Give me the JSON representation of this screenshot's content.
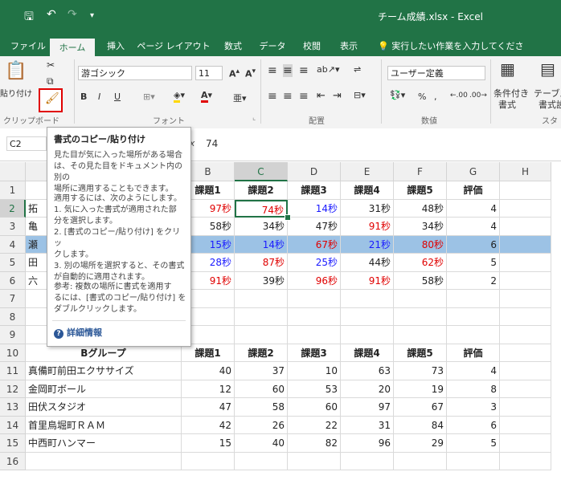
{
  "title_bar": {
    "title": "チーム成績.xlsx  -  Excel",
    "save_icon": "save-icon",
    "undo_icon": "undo-icon",
    "redo_icon": "redo-icon"
  },
  "tabs": [
    {
      "label": "ファイル"
    },
    {
      "label": "ホーム"
    },
    {
      "label": "挿入"
    },
    {
      "label": "ページ レイアウト"
    },
    {
      "label": "数式"
    },
    {
      "label": "データ"
    },
    {
      "label": "校閲"
    },
    {
      "label": "表示"
    }
  ],
  "tell_me": "実行したい作業を入力してください",
  "ribbon": {
    "paste_label": "貼り付け",
    "clipboard_label": "クリップボード",
    "font_name": "游ゴシック",
    "font_size": "11",
    "font_group_label": "フォント",
    "align_group_label": "配置",
    "number_format": "ユーザー定義",
    "number_group_label": "数値",
    "conditional_label_1": "条件付き",
    "conditional_label_2": "書式",
    "table_label_1": "テーブル",
    "table_label_2": "書式設",
    "styles_label": "スタ",
    "bold": "B",
    "italic": "I",
    "underline": "U",
    "percent": "%",
    "comma": ","
  },
  "formula_bar": {
    "name_box": "C2",
    "fx": "fx",
    "value": "74"
  },
  "tooltip": {
    "title": "書式のコピー/貼り付け",
    "para1": [
      "見た目が気に入った場所がある場合",
      "は、その見た目をドキュメント内の別の",
      "場所に適用することもできます。"
    ],
    "para2": [
      "適用するには、次のようにします。",
      "1. 気に入った書式が適用された部",
      "分を選択します。",
      "2. [書式のコピー/貼り付け] をクリッ",
      "クします。",
      "3. 別の場所を選択すると、その書式",
      "が自動的に適用されます。"
    ],
    "para3": [
      "参考: 複数の場所に書式を適用す",
      "るには、[書式のコピー/貼り付け] を",
      "ダブルクリックします。"
    ],
    "help": "詳細情報"
  },
  "columns": [
    "A",
    "B",
    "C",
    "D",
    "E",
    "F",
    "G",
    "H"
  ],
  "selected_column": "C",
  "row_numbers": [
    "1",
    "2",
    "3",
    "4",
    "5",
    "6",
    "7",
    "8",
    "9",
    "10",
    "11",
    "12",
    "13",
    "14",
    "15",
    "16"
  ],
  "sheet": {
    "header_row1": [
      "",
      "課題1",
      "課題2",
      "課題3",
      "課題4",
      "課題5",
      "評価"
    ],
    "rows_top": [
      {
        "name": "拓",
        "cells": [
          {
            "v": "97秒",
            "c": "red"
          },
          {
            "v": "74秒",
            "c": "red"
          },
          {
            "v": "14秒",
            "c": "blue"
          },
          {
            "v": "31秒",
            "c": ""
          },
          {
            "v": "48秒",
            "c": ""
          },
          {
            "v": "4",
            "c": ""
          }
        ]
      },
      {
        "name": "亀",
        "cells": [
          {
            "v": "58秒",
            "c": ""
          },
          {
            "v": "34秒",
            "c": ""
          },
          {
            "v": "47秒",
            "c": ""
          },
          {
            "v": "91秒",
            "c": "red"
          },
          {
            "v": "34秒",
            "c": ""
          },
          {
            "v": "4",
            "c": ""
          }
        ]
      },
      {
        "name": "瀬",
        "cells": [
          {
            "v": "15秒",
            "c": "blue"
          },
          {
            "v": "14秒",
            "c": "blue"
          },
          {
            "v": "67秒",
            "c": "red"
          },
          {
            "v": "21秒",
            "c": "blue"
          },
          {
            "v": "80秒",
            "c": "red"
          },
          {
            "v": "6",
            "c": ""
          }
        ]
      },
      {
        "name": "田",
        "cells": [
          {
            "v": "28秒",
            "c": "blue"
          },
          {
            "v": "87秒",
            "c": "red"
          },
          {
            "v": "25秒",
            "c": "blue"
          },
          {
            "v": "44秒",
            "c": ""
          },
          {
            "v": "62秒",
            "c": "red"
          },
          {
            "v": "5",
            "c": ""
          }
        ]
      },
      {
        "name": "六",
        "cells": [
          {
            "v": "91秒",
            "c": "red"
          },
          {
            "v": "39秒",
            "c": ""
          },
          {
            "v": "96秒",
            "c": "red"
          },
          {
            "v": "91秒",
            "c": "red"
          },
          {
            "v": "58秒",
            "c": ""
          },
          {
            "v": "2",
            "c": ""
          }
        ]
      }
    ],
    "header_row10": [
      "Bグループ",
      "課題1",
      "課題2",
      "課題3",
      "課題4",
      "課題5",
      "評価"
    ],
    "rows_bottom": [
      {
        "name": "真備町前田エクササイズ",
        "cells": [
          "40",
          "37",
          "10",
          "63",
          "73",
          "4"
        ]
      },
      {
        "name": "金岡町ボール",
        "cells": [
          "12",
          "60",
          "53",
          "20",
          "19",
          "8"
        ]
      },
      {
        "name": "田伏スタジオ",
        "cells": [
          "47",
          "58",
          "60",
          "97",
          "67",
          "3"
        ]
      },
      {
        "name": "首里鳥堀町ＲＡＭ",
        "cells": [
          "42",
          "26",
          "22",
          "31",
          "84",
          "6"
        ]
      },
      {
        "name": "中西町ハンマー",
        "cells": [
          "15",
          "40",
          "82",
          "96",
          "29",
          "5"
        ]
      }
    ]
  }
}
